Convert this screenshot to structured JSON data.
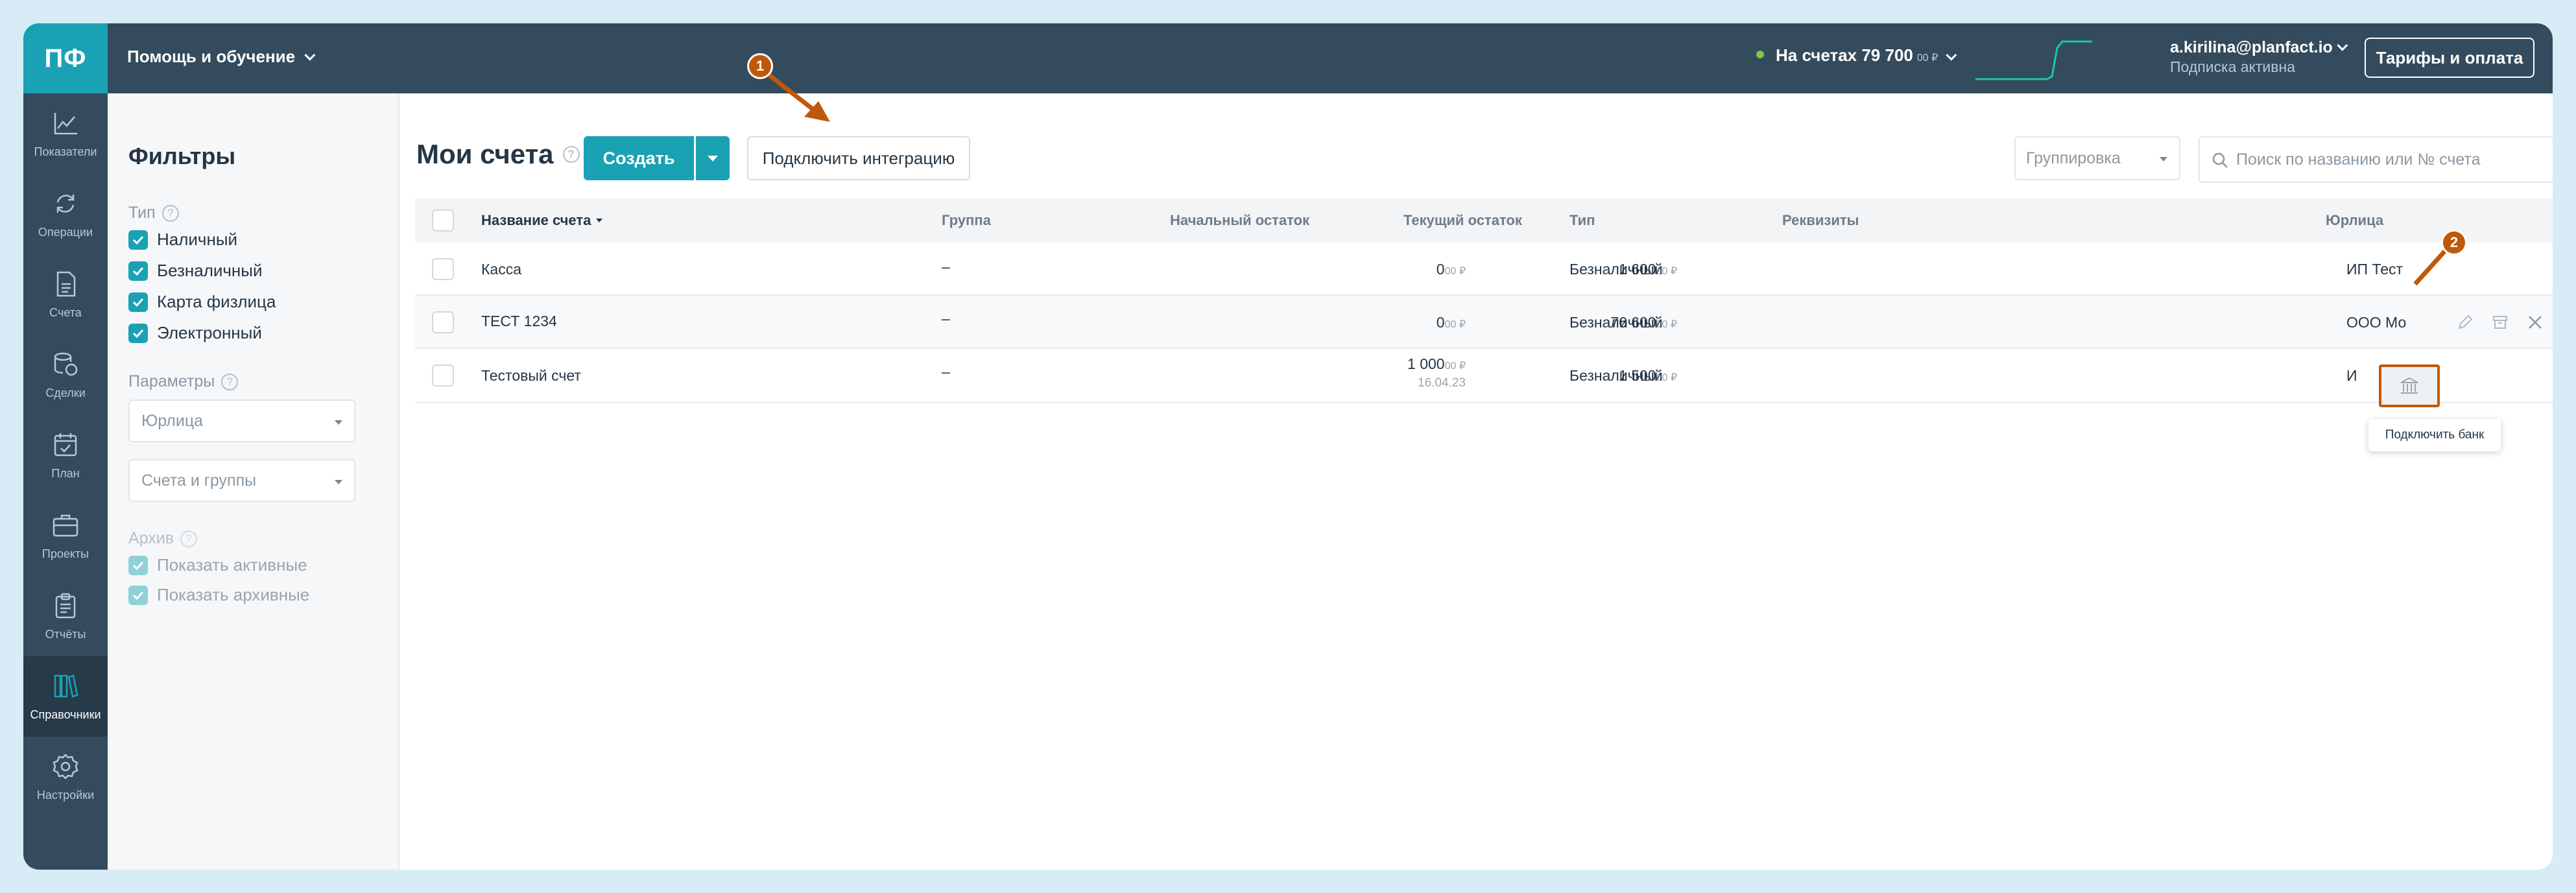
{
  "app": {
    "logo": "ПФ"
  },
  "topbar": {
    "help_label": "Помощь и обучение",
    "balance_label": "На счетах 79 700",
    "balance_cents": "00 ₽",
    "user_email": "a.kirilina@planfact.io",
    "user_status": "Подписка активна",
    "tariff_button": "Тарифы и оплата"
  },
  "sidebar": {
    "items": [
      {
        "label": "Показатели",
        "icon": "chart-line-icon"
      },
      {
        "label": "Операции",
        "icon": "refresh-icon"
      },
      {
        "label": "Счета",
        "icon": "document-icon"
      },
      {
        "label": "Сделки",
        "icon": "coins-icon"
      },
      {
        "label": "План",
        "icon": "calendar-icon"
      },
      {
        "label": "Проекты",
        "icon": "briefcase-icon"
      },
      {
        "label": "Отчёты",
        "icon": "clipboard-icon"
      },
      {
        "label": "Справочники",
        "icon": "books-icon",
        "active": true
      },
      {
        "label": "Настройки",
        "icon": "gear-icon"
      }
    ]
  },
  "filters": {
    "title": "Фильтры",
    "type_label": "Тип",
    "types": [
      "Наличный",
      "Безналичный",
      "Карта физлица",
      "Электронный"
    ],
    "params_label": "Параметры",
    "legal_entity_placeholder": "Юрлица",
    "accounts_groups_placeholder": "Счета и группы",
    "archive_label": "Архив",
    "archive_options": [
      "Показать активные",
      "Показать архивные"
    ]
  },
  "main": {
    "title": "Мои счета",
    "create_button": "Создать",
    "integration_button": "Подключить интеграцию",
    "grouping_placeholder": "Группировка",
    "search_placeholder": "Поиск по названию или № счета",
    "columns": [
      "Название счета",
      "Группа",
      "Начальный остаток",
      "Текущий остаток",
      "Тип",
      "Реквизиты",
      "Юрлица"
    ],
    "rows": [
      {
        "name": "Касса",
        "group": "–",
        "start_main": "0",
        "start_cents": "00 ₽",
        "start_date": "",
        "current_main": "1 600",
        "current_cents": "00 ₽",
        "type": "Безналичный",
        "entity": "ИП Тест"
      },
      {
        "name": "ТЕСТ 1234",
        "group": "–",
        "start_main": "0",
        "start_cents": "00 ₽",
        "start_date": "",
        "current_main": "76 600",
        "current_cents": "00 ₽",
        "type": "Безналичный",
        "entity": "ООО Мо"
      },
      {
        "name": "Тестовый счет",
        "group": "–",
        "start_main": "1 000",
        "start_cents": "00 ₽",
        "start_date": "16.04.23",
        "current_main": "1 500",
        "current_cents": "00 ₽",
        "type": "Безналичный",
        "entity": "И"
      }
    ],
    "tooltip": "Подключить банк"
  },
  "annotations": {
    "badge_1": "1",
    "badge_2": "2",
    "accent": "#c0580a"
  },
  "colors": {
    "topbar": "#334b5c",
    "accent": "#1aa1b4"
  }
}
